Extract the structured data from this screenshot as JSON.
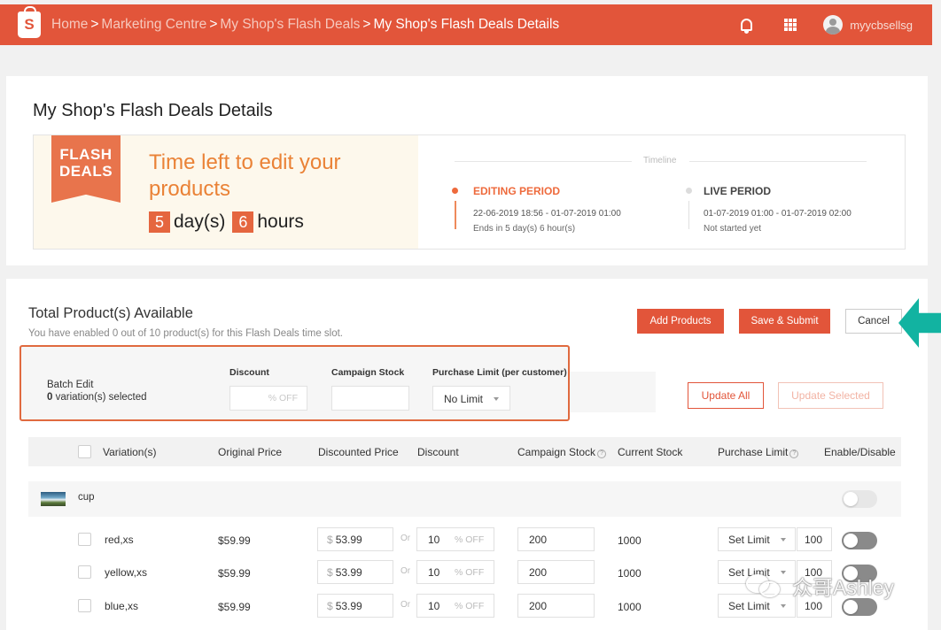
{
  "header": {
    "logo_letter": "S",
    "breadcrumb": [
      "Home",
      "Marketing Centre",
      "My Shop's Flash Deals",
      "My Shop's Flash Deals Details"
    ],
    "separator": ">",
    "username": "myycbsellsg",
    "icons": [
      "bell-icon",
      "apps-grid-icon",
      "user-avatar-icon"
    ],
    "brand_color": "#e2553a"
  },
  "details": {
    "title": "My Shop's Flash Deals Details",
    "badge_line1": "FLASH",
    "badge_line2": "DEALS",
    "edit_title": "Time left to edit your products",
    "days_value": "5",
    "days_unit": "day(s)",
    "hours_value": "6",
    "hours_unit": "hours",
    "timeline_label": "Timeline",
    "editing": {
      "name": "EDITING PERIOD",
      "range": "22-06-2019 18:56 - 01-07-2019 01:00",
      "status": "Ends in 5 day(s) 6 hour(s)"
    },
    "live": {
      "name": "LIVE PERIOD",
      "range": "01-07-2019 01:00 - 01-07-2019 02:00",
      "status": "Not started yet"
    }
  },
  "products": {
    "title": "Total Product(s) Available",
    "subtitle": "You have enabled 0 out of 10 product(s) for this Flash Deals time slot.",
    "add_label": "Add Products",
    "save_label": "Save & Submit",
    "cancel_label": "Cancel"
  },
  "batch": {
    "label": "Batch Edit",
    "selected_count": "0",
    "selected_suffix": " variation(s) selected",
    "discount_label": "Discount",
    "discount_placeholder": "% OFF",
    "stock_label": "Campaign Stock",
    "limit_label": "Purchase Limit (per customer)",
    "limit_value": "No Limit",
    "update_all": "Update All",
    "update_selected": "Update Selected"
  },
  "table": {
    "columns": [
      "Variation(s)",
      "Original Price",
      "Discounted Price",
      "Discount",
      "Campaign Stock",
      "Current Stock",
      "Purchase Limit",
      "Enable/Disable"
    ],
    "help_glyph": "?",
    "group_name": "cup",
    "currency": "$",
    "or_label": "Or",
    "discount_suffix": "% OFF",
    "rows": [
      {
        "variation": "red,xs",
        "original": "$59.99",
        "discounted": "53.99",
        "discount": "10",
        "campaign_stock": "200",
        "current_stock": "1000",
        "limit_option": "Set Limit",
        "limit": "100"
      },
      {
        "variation": "yellow,xs",
        "original": "$59.99",
        "discounted": "53.99",
        "discount": "10",
        "campaign_stock": "200",
        "current_stock": "1000",
        "limit_option": "Set Limit",
        "limit": "100"
      },
      {
        "variation": "blue,xs",
        "original": "$59.99",
        "discounted": "53.99",
        "discount": "10",
        "campaign_stock": "200",
        "current_stock": "1000",
        "limit_option": "Set Limit",
        "limit": "100"
      }
    ]
  },
  "watermark": "众哥Ashley"
}
